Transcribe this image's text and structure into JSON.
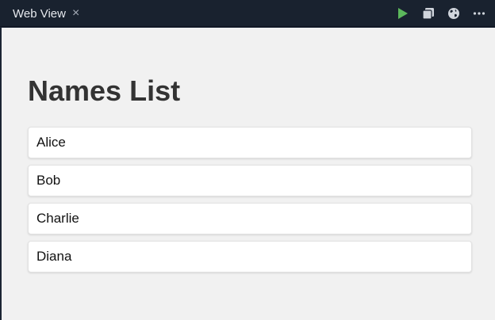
{
  "tab": {
    "title": "Web View",
    "close_glyph": "×"
  },
  "toolbar": {
    "icons": [
      "run-icon",
      "stop-icon",
      "globe-icon",
      "more-icon"
    ],
    "run_color": "#5cb85c"
  },
  "page": {
    "heading": "Names List"
  },
  "names": [
    "Alice",
    "Bob",
    "Charlie",
    "Diana"
  ]
}
